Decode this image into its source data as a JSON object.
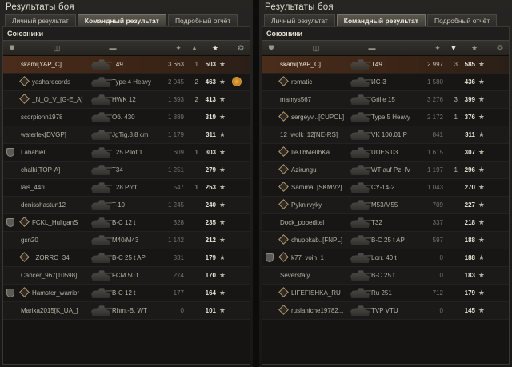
{
  "panels": [
    {
      "title": "Результаты боя",
      "tabs": [
        {
          "label": "Личный результат",
          "active": false
        },
        {
          "label": "Командный результат",
          "active": true
        },
        {
          "label": "Подробный отчёт",
          "active": false
        }
      ],
      "section": "Союзники",
      "rows": [
        {
          "name": "skami[YAP_C]",
          "tank": "T49",
          "damage": "3 663",
          "kills": "1",
          "xp": "503",
          "highlight": true,
          "clan_icon": false,
          "platoon_icon": false,
          "medal": false
        },
        {
          "name": "yasharecords",
          "tank": "Type 4 Heavy",
          "damage": "2 045",
          "kills": "2",
          "xp": "463",
          "highlight": false,
          "clan_icon": false,
          "platoon_icon": true,
          "medal": true
        },
        {
          "name": "_N_O_V_[G-E_A]",
          "tank": "HWK 12",
          "damage": "1 393",
          "kills": "2",
          "xp": "413",
          "highlight": false,
          "clan_icon": false,
          "platoon_icon": true,
          "medal": false
        },
        {
          "name": "scorpionn1978",
          "tank": "Об. 430",
          "damage": "1 889",
          "kills": "",
          "xp": "319",
          "highlight": false,
          "clan_icon": false,
          "platoon_icon": false,
          "medal": false
        },
        {
          "name": "waterlek[DVGP]",
          "tank": "JgTig.8,8 cm",
          "damage": "1 179",
          "kills": "",
          "xp": "311",
          "highlight": false,
          "clan_icon": false,
          "platoon_icon": false,
          "medal": false
        },
        {
          "name": "Lahabiel",
          "tank": "T25 Pilot 1",
          "damage": "609",
          "kills": "1",
          "xp": "303",
          "highlight": false,
          "clan_icon": true,
          "platoon_icon": false,
          "medal": false
        },
        {
          "name": "chalki[TOP-A]",
          "tank": "T34",
          "damage": "1 251",
          "kills": "",
          "xp": "279",
          "highlight": false,
          "clan_icon": false,
          "platoon_icon": false,
          "medal": false
        },
        {
          "name": "lais_44ru",
          "tank": "T28 Prot.",
          "damage": "547",
          "kills": "1",
          "xp": "253",
          "highlight": false,
          "clan_icon": false,
          "platoon_icon": false,
          "medal": false
        },
        {
          "name": "denisshastun12",
          "tank": "T-10",
          "damage": "1 245",
          "kills": "",
          "xp": "240",
          "highlight": false,
          "clan_icon": false,
          "platoon_icon": false,
          "medal": false
        },
        {
          "name": "FCKL_HuliganS",
          "tank": "B-C 12 t",
          "damage": "328",
          "kills": "",
          "xp": "235",
          "highlight": false,
          "clan_icon": true,
          "platoon_icon": true,
          "medal": false
        },
        {
          "name": "gsn20",
          "tank": "M40/M43",
          "damage": "1 142",
          "kills": "",
          "xp": "212",
          "highlight": false,
          "clan_icon": false,
          "platoon_icon": false,
          "medal": false
        },
        {
          "name": "_ZORRO_34",
          "tank": "B-C 25 t AP",
          "damage": "331",
          "kills": "",
          "xp": "179",
          "highlight": false,
          "clan_icon": false,
          "platoon_icon": true,
          "medal": false
        },
        {
          "name": "Cancer_967[10598]",
          "tank": "FCM 50 t",
          "damage": "274",
          "kills": "",
          "xp": "170",
          "highlight": false,
          "clan_icon": false,
          "platoon_icon": false,
          "medal": false
        },
        {
          "name": "Hamster_warrior",
          "tank": "B-C 12 t",
          "damage": "177",
          "kills": "",
          "xp": "164",
          "highlight": false,
          "clan_icon": true,
          "platoon_icon": true,
          "medal": false
        },
        {
          "name": "Marixa2015[K_UA_]",
          "tank": "Rhm.-B. WT",
          "damage": "0",
          "kills": "",
          "xp": "101",
          "highlight": false,
          "clan_icon": false,
          "platoon_icon": false,
          "medal": false
        }
      ]
    },
    {
      "title": "Результаты боя",
      "tabs": [
        {
          "label": "Личный результат",
          "active": false
        },
        {
          "label": "Командный результат",
          "active": true
        },
        {
          "label": "Подробный отчёт",
          "active": false
        }
      ],
      "section": "Союзники",
      "rows": [
        {
          "name": "skami[YAP_C]",
          "tank": "T49",
          "damage": "2 997",
          "kills": "3",
          "xp": "585",
          "highlight": true,
          "clan_icon": false,
          "platoon_icon": false,
          "medal": false
        },
        {
          "name": "romatic",
          "tank": "ИС-3",
          "damage": "1 580",
          "kills": "",
          "xp": "436",
          "highlight": false,
          "clan_icon": false,
          "platoon_icon": true,
          "medal": false
        },
        {
          "name": "mamys567",
          "tank": "Grille 15",
          "damage": "3 276",
          "kills": "3",
          "xp": "399",
          "highlight": false,
          "clan_icon": false,
          "platoon_icon": false,
          "medal": false
        },
        {
          "name": "sergeyv...[CUPOL]",
          "tank": "Type 5 Heavy",
          "damage": "2 172",
          "kills": "1",
          "xp": "376",
          "highlight": false,
          "clan_icon": false,
          "platoon_icon": true,
          "medal": false
        },
        {
          "name": "12_wolk_12[NE-RS]",
          "tank": "VK 100.01 P",
          "damage": "841",
          "kills": "",
          "xp": "311",
          "highlight": false,
          "clan_icon": false,
          "platoon_icon": false,
          "medal": false
        },
        {
          "name": "IleJlbMelIbKa",
          "tank": "UDES 03",
          "damage": "1 615",
          "kills": "",
          "xp": "307",
          "highlight": false,
          "clan_icon": false,
          "platoon_icon": true,
          "medal": false
        },
        {
          "name": "Azirungu",
          "tank": "WT auf Pz. IV",
          "damage": "1 197",
          "kills": "1",
          "xp": "296",
          "highlight": false,
          "clan_icon": false,
          "platoon_icon": true,
          "medal": false
        },
        {
          "name": "Samma..[SKMV2]",
          "tank": "СУ-14-2",
          "damage": "1 043",
          "kills": "",
          "xp": "270",
          "highlight": false,
          "clan_icon": false,
          "platoon_icon": true,
          "medal": false
        },
        {
          "name": "Pyknirvyky",
          "tank": "M53/M55",
          "damage": "709",
          "kills": "",
          "xp": "227",
          "highlight": false,
          "clan_icon": false,
          "platoon_icon": true,
          "medal": false
        },
        {
          "name": "Dock_pobeditel",
          "tank": "T32",
          "damage": "337",
          "kills": "",
          "xp": "218",
          "highlight": false,
          "clan_icon": false,
          "platoon_icon": false,
          "medal": false
        },
        {
          "name": "chupokab..[FNPL]",
          "tank": "B-C 25 t AP",
          "damage": "597",
          "kills": "",
          "xp": "188",
          "highlight": false,
          "clan_icon": false,
          "platoon_icon": true,
          "medal": false
        },
        {
          "name": "k77_voin_1",
          "tank": "Lorr. 40 t",
          "damage": "0",
          "kills": "",
          "xp": "188",
          "highlight": false,
          "clan_icon": true,
          "platoon_icon": true,
          "medal": false
        },
        {
          "name": "Severstaly",
          "tank": "B-C 25 t",
          "damage": "0",
          "kills": "",
          "xp": "183",
          "highlight": false,
          "clan_icon": false,
          "platoon_icon": false,
          "medal": false
        },
        {
          "name": "LIFEFISHKA_RU",
          "tank": "Ru 251",
          "damage": "712",
          "kills": "",
          "xp": "179",
          "highlight": false,
          "clan_icon": false,
          "platoon_icon": true,
          "medal": false
        },
        {
          "name": "ruslaniche19782...",
          "tank": "TVP VTU",
          "damage": "0",
          "kills": "",
          "xp": "145",
          "highlight": false,
          "clan_icon": false,
          "platoon_icon": true,
          "medal": false
        }
      ]
    }
  ],
  "colors": {
    "highlight": "#4a2c1a",
    "medal": "#f1b03b",
    "accent": "#e6e1d4"
  },
  "header_icons": [
    "clan-icon",
    "platoon-icon",
    "player-icon",
    "tank-icon",
    "damage-icon",
    "kills-icon",
    "xp-star-icon",
    "medal-icon"
  ]
}
